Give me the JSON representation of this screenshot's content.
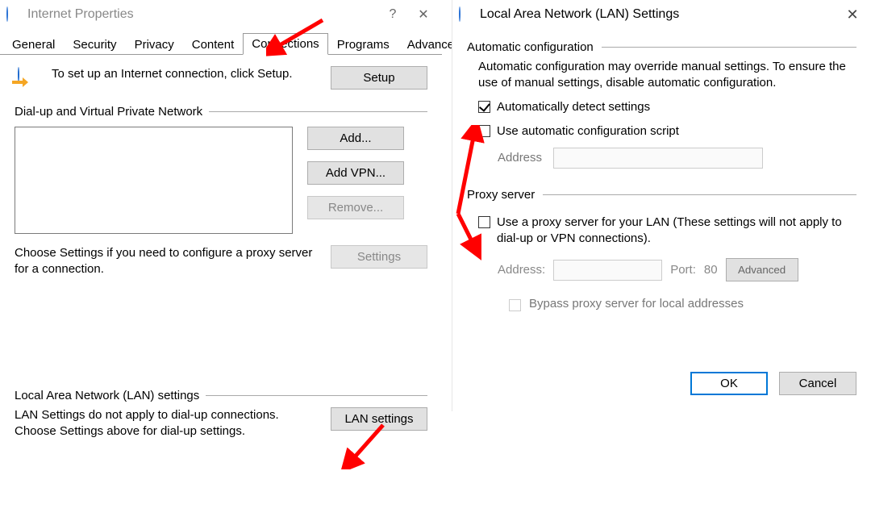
{
  "ip": {
    "title": "Internet Properties",
    "tabs": [
      "General",
      "Security",
      "Privacy",
      "Content",
      "Connections",
      "Programs",
      "Advanced"
    ],
    "active_tab": 4,
    "setup_text": "To set up an Internet connection, click Setup.",
    "btn_setup": "Setup",
    "dialup_label": "Dial-up and Virtual Private Network",
    "btn_add": "Add...",
    "btn_add_vpn": "Add VPN...",
    "btn_remove": "Remove...",
    "choose_text": "Choose Settings if you need to configure a proxy server for a connection.",
    "btn_settings": "Settings",
    "lan_label": "Local Area Network (LAN) settings",
    "lan_text": "LAN Settings do not apply to dial-up connections. Choose Settings above for dial-up settings.",
    "btn_lan": "LAN settings"
  },
  "lan": {
    "title": "Local Area Network (LAN) Settings",
    "auto_label": "Automatic configuration",
    "auto_text": "Automatic configuration may override manual settings.  To ensure the use of manual settings, disable automatic configuration.",
    "chk_auto_detect": "Automatically detect settings",
    "chk_auto_script": "Use automatic configuration script",
    "address_label": "Address",
    "proxy_label": "Proxy server",
    "chk_use_proxy": "Use a proxy server for your LAN (These settings will not apply to dial-up or VPN connections).",
    "addr_label": "Address:",
    "port_label": "Port:",
    "port_value": "80",
    "btn_advanced": "Advanced",
    "chk_bypass": "Bypass proxy server for local addresses",
    "btn_ok": "OK",
    "btn_cancel": "Cancel"
  }
}
